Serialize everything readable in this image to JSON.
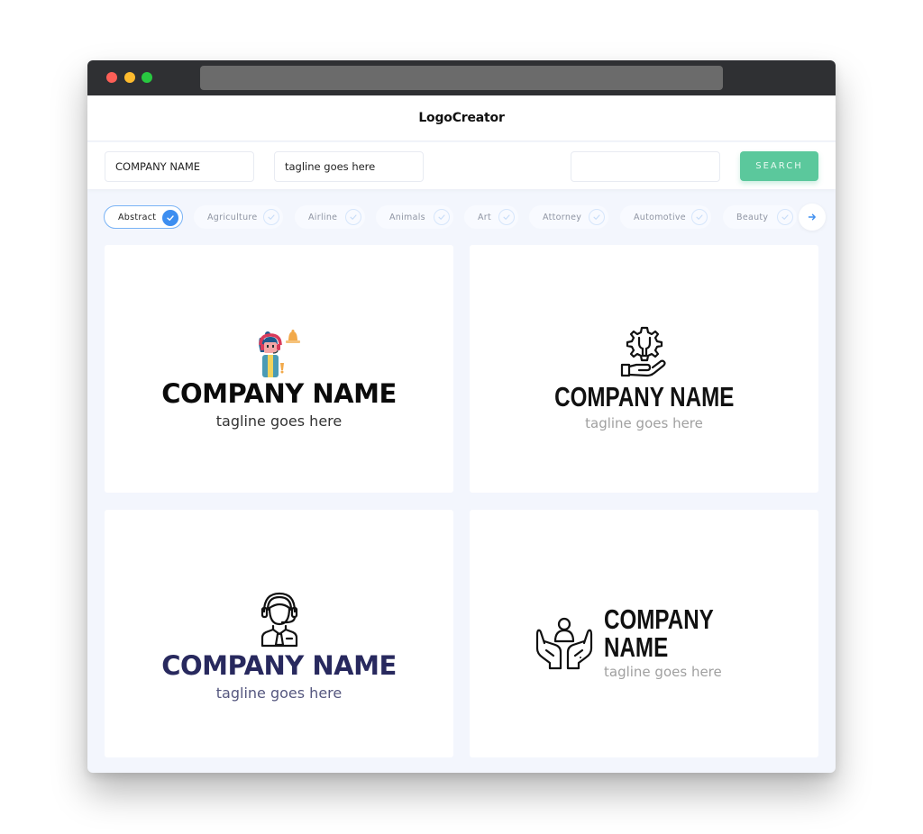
{
  "browser": {
    "traffic_lights": [
      "close",
      "minimize",
      "maximize"
    ],
    "address": ""
  },
  "app": {
    "title": "LogoCreator"
  },
  "search": {
    "company_name_value": "COMPANY NAME",
    "tagline_value": "tagline goes here",
    "extra_value": "",
    "button_label": "SEARCH"
  },
  "categories": {
    "items": [
      {
        "label": "Abstract",
        "selected": true
      },
      {
        "label": "Agriculture",
        "selected": false
      },
      {
        "label": "Airline",
        "selected": false
      },
      {
        "label": "Animals",
        "selected": false
      },
      {
        "label": "Art",
        "selected": false
      },
      {
        "label": "Attorney",
        "selected": false
      },
      {
        "label": "Automotive",
        "selected": false
      },
      {
        "label": "Beauty",
        "selected": false
      }
    ],
    "next_icon": "arrow-right-icon"
  },
  "logos": [
    {
      "icon": "customer-support-girl-bell-icon",
      "company": "COMPANY NAME",
      "tagline": "tagline goes here",
      "layout": "stacked",
      "name_color": "#0b0b0b"
    },
    {
      "icon": "hand-gear-wrench-icon",
      "company": "COMPANY NAME",
      "tagline": "tagline goes here",
      "layout": "stacked",
      "name_color": "#111111"
    },
    {
      "icon": "headset-operator-icon",
      "company": "COMPANY NAME",
      "tagline": "tagline goes here",
      "layout": "stacked",
      "name_color": "#28295e"
    },
    {
      "icon": "hands-holding-person-icon",
      "company": "COMPANY NAME",
      "tagline": "tagline goes here",
      "layout": "inline",
      "name_color": "#111111"
    }
  ],
  "colors": {
    "accent_green": "#5bc89c",
    "accent_blue": "#3d8ef0",
    "navy": "#28295e",
    "background": "#f3f6fd"
  }
}
